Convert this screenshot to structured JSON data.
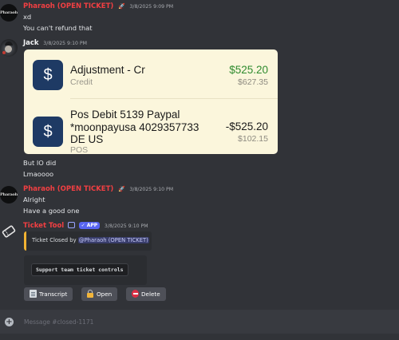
{
  "messages": [
    {
      "author": "Pharaoh (OPEN TICKET)",
      "timestamp": "3/8/2025 9:09 PM",
      "avatar_text": "Pharaoh",
      "lines": [
        "xd",
        "You can't refund that"
      ]
    },
    {
      "author": "Jack",
      "timestamp": "3/8/2025 9:10 PM",
      "lines_after": [
        "But IO did",
        "Lmaoooo"
      ]
    },
    {
      "author": "Pharaoh (OPEN TICKET)",
      "timestamp": "3/8/2025 9:10 PM",
      "avatar_text": "Pharaoh",
      "lines": [
        "Alright",
        "Have a good one"
      ]
    },
    {
      "author": "Ticket Tool",
      "app_badge": "APP",
      "timestamp": "3/8/2025 9:10 PM"
    }
  ],
  "bank_card": {
    "transactions": [
      {
        "title": "Adjustment - Cr",
        "subtitle": "Credit",
        "amount": "$525.20",
        "balance": "$627.35",
        "amount_color": "#2e8b2e"
      },
      {
        "title_lines": [
          "Pos Debit 5139 Paypal",
          "*moonpayusa 4029357733",
          "DE US"
        ],
        "subtitle": "POS",
        "amount": "-$525.20",
        "balance": "$102.15"
      }
    ],
    "icon_glyph": "$"
  },
  "ticket_embed": {
    "text": "Ticket Closed by",
    "mention": "@Pharaoh (OPEN TICKET)",
    "accent_color": "#f0b232"
  },
  "controls_embed": {
    "code_text": "Support team ticket controls"
  },
  "buttons": [
    {
      "label": "Transcript",
      "icon": "document-icon"
    },
    {
      "label": "Open",
      "icon": "lock-icon"
    },
    {
      "label": "Delete",
      "icon": "no-entry-icon"
    }
  ],
  "composer": {
    "placeholder": "Message #closed-1171"
  },
  "colors": {
    "background": "#313338",
    "name_red": "#f23f42",
    "app_badge": "#5865f2"
  }
}
